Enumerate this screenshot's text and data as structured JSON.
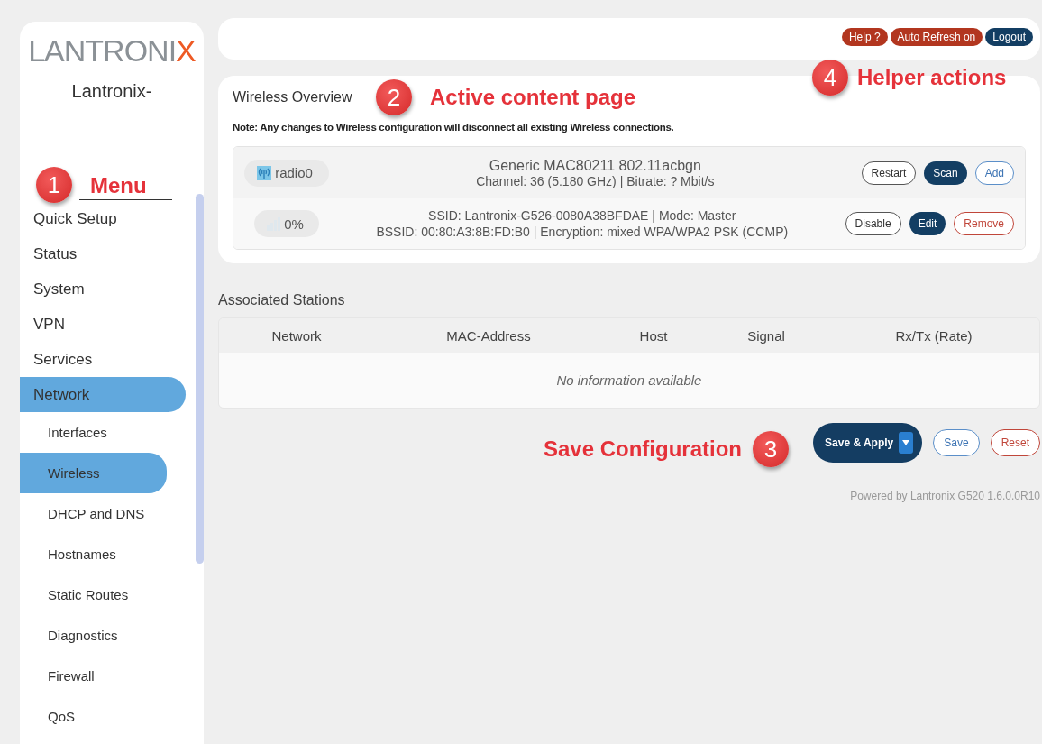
{
  "sidebar": {
    "logo": {
      "text": "LANTRONI",
      "accent": "X"
    },
    "hostname": "Lantronix-",
    "menu": [
      {
        "label": "Quick Setup",
        "selected": false
      },
      {
        "label": "Status",
        "selected": false
      },
      {
        "label": "System",
        "selected": false
      },
      {
        "label": "VPN",
        "selected": false
      },
      {
        "label": "Services",
        "selected": false
      },
      {
        "label": "Network",
        "selected": true,
        "children": [
          {
            "label": "Interfaces",
            "selected": false
          },
          {
            "label": "Wireless",
            "selected": true
          },
          {
            "label": "DHCP and DNS",
            "selected": false
          },
          {
            "label": "Hostnames",
            "selected": false
          },
          {
            "label": "Static Routes",
            "selected": false
          },
          {
            "label": "Diagnostics",
            "selected": false
          },
          {
            "label": "Firewall",
            "selected": false
          },
          {
            "label": "QoS",
            "selected": false
          }
        ]
      }
    ]
  },
  "header": {
    "buttons": [
      {
        "label": "Help ?",
        "kind": "warning"
      },
      {
        "label": "Auto Refresh on",
        "kind": "warning"
      },
      {
        "label": "Logout",
        "kind": "primary"
      }
    ]
  },
  "wireless_overview": {
    "title": "Wireless Overview",
    "note": "Note: Any changes to Wireless configuration will disconnect all existing Wireless connections.",
    "devices": [
      {
        "kind": "radio",
        "badge": "radio0",
        "line1": "Generic MAC80211 802.11acbgn",
        "line2": "Channel: 36 (5.180 GHz) | Bitrate: ? Mbit/s",
        "buttons": [
          {
            "label": "Restart",
            "kind": "neutral"
          },
          {
            "label": "Scan",
            "kind": "primary"
          },
          {
            "label": "Add",
            "kind": "add"
          }
        ]
      },
      {
        "kind": "network",
        "badge": "0%",
        "line1": "SSID: Lantronix-G526-0080A38BFDAE | Mode: Master",
        "line2": "BSSID: 00:80:A3:8B:FD:B0 | Encryption: mixed WPA/WPA2 PSK (CCMP)",
        "buttons": [
          {
            "label": "Disable",
            "kind": "neutral"
          },
          {
            "label": "Edit",
            "kind": "primary"
          },
          {
            "label": "Remove",
            "kind": "remove"
          }
        ]
      }
    ]
  },
  "associated_stations": {
    "title": "Associated Stations",
    "columns": [
      "Network",
      "MAC-Address",
      "Host",
      "Signal",
      "Rx/Tx (Rate)"
    ],
    "empty_text": "No information available"
  },
  "actions": {
    "buttons": [
      {
        "label": "Save & Apply",
        "kind": "apply"
      },
      {
        "label": "Save",
        "kind": "add"
      },
      {
        "label": "Reset",
        "kind": "remove"
      }
    ]
  },
  "footer": "Powered by Lantronix G520 1.6.0.0R10",
  "annotations": [
    {
      "number": "1",
      "label": "Menu"
    },
    {
      "number": "2",
      "label": "Active content page"
    },
    {
      "number": "3",
      "label": "Save Configuration"
    },
    {
      "number": "4",
      "label": "Helper actions"
    }
  ]
}
